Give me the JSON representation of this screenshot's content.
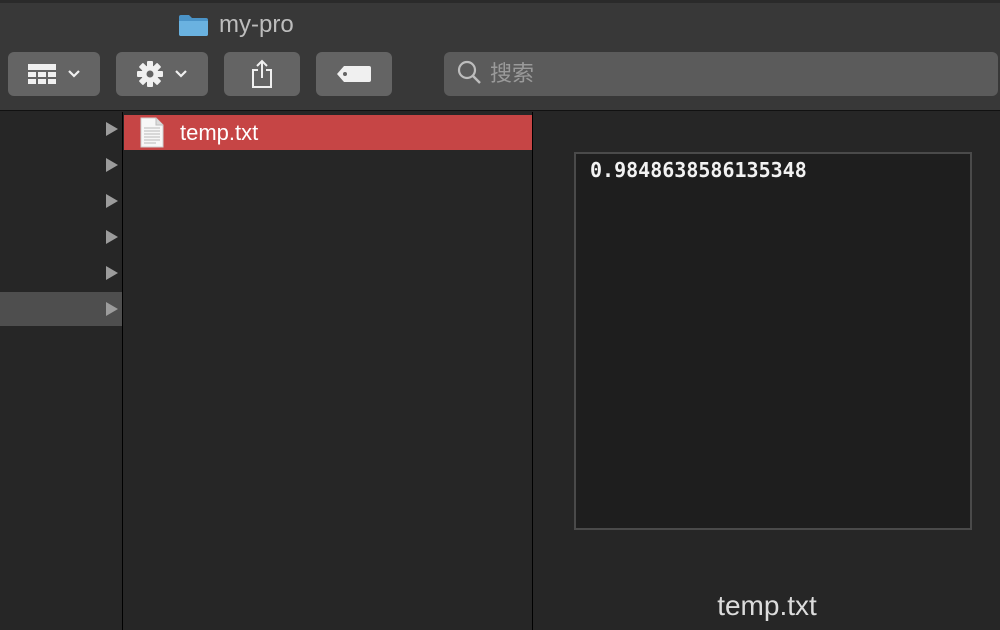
{
  "window": {
    "title": "my-pro"
  },
  "toolbar": {
    "view_icon": "grid-view-icon",
    "action_icon": "gear-icon",
    "share_icon": "share-icon",
    "tag_icon": "tag-icon",
    "dropdown_icon": "chevron-down-icon"
  },
  "search": {
    "placeholder": "搜索",
    "value": ""
  },
  "sidebar_column": {
    "rows": [
      {
        "expandable": true,
        "selected": false
      },
      {
        "expandable": true,
        "selected": false
      },
      {
        "expandable": true,
        "selected": false
      },
      {
        "expandable": true,
        "selected": false
      },
      {
        "expandable": true,
        "selected": false
      },
      {
        "expandable": true,
        "selected": true
      }
    ]
  },
  "files": [
    {
      "name": "temp.txt",
      "icon": "text-document-icon",
      "selected": true
    }
  ],
  "preview": {
    "content": "0.9848638586135348",
    "caption": "temp.txt"
  },
  "colors": {
    "selection": "#c64545",
    "toolbar": "#383838",
    "button": "#646464"
  }
}
